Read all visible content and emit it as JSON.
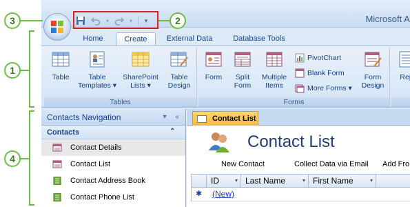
{
  "app": {
    "title": "Microsoft Acce"
  },
  "quick_access": {
    "save_icon": "save-icon",
    "undo_icon": "undo-icon",
    "redo_icon": "redo-icon",
    "customize_icon": "customize-qat-icon"
  },
  "tabs": [
    {
      "label": "Home"
    },
    {
      "label": "Create"
    },
    {
      "label": "External Data"
    },
    {
      "label": "Database Tools"
    }
  ],
  "ribbon": {
    "tables": {
      "label": "Tables",
      "buttons": [
        {
          "line1": "Table",
          "line2": ""
        },
        {
          "line1": "Table",
          "line2": "Templates ▾"
        },
        {
          "line1": "SharePoint",
          "line2": "Lists ▾"
        },
        {
          "line1": "Table",
          "line2": "Design"
        }
      ]
    },
    "forms": {
      "label": "Forms",
      "buttons": [
        {
          "line1": "Form",
          "line2": ""
        },
        {
          "line1": "Split",
          "line2": "Form"
        },
        {
          "line1": "Multiple",
          "line2": "Items"
        },
        {
          "line1": "Form",
          "line2": "Design"
        }
      ],
      "small": [
        "PivotChart",
        "Blank Form",
        "More Forms ▾"
      ]
    },
    "reports_partial": "Rep"
  },
  "nav": {
    "title": "Contacts Navigation",
    "group": "Contacts",
    "items": [
      {
        "label": "Contact Details"
      },
      {
        "label": "Contact List"
      },
      {
        "label": "Contact Address Book"
      },
      {
        "label": "Contact Phone List"
      }
    ]
  },
  "document": {
    "tab": "Contact List",
    "title": "Contact List",
    "links": [
      "New Contact",
      "Collect Data via Email",
      "Add Fro"
    ],
    "columns": [
      "ID",
      "Last Name",
      "First Name"
    ],
    "new_row_marker": "✱",
    "new_row_value": "(New)"
  },
  "callouts": [
    "1",
    "2",
    "3",
    "4"
  ],
  "colors": {
    "callout": "#6fba44",
    "highlight_box": "#d61f26",
    "doc_tab": "#f5b93f"
  }
}
